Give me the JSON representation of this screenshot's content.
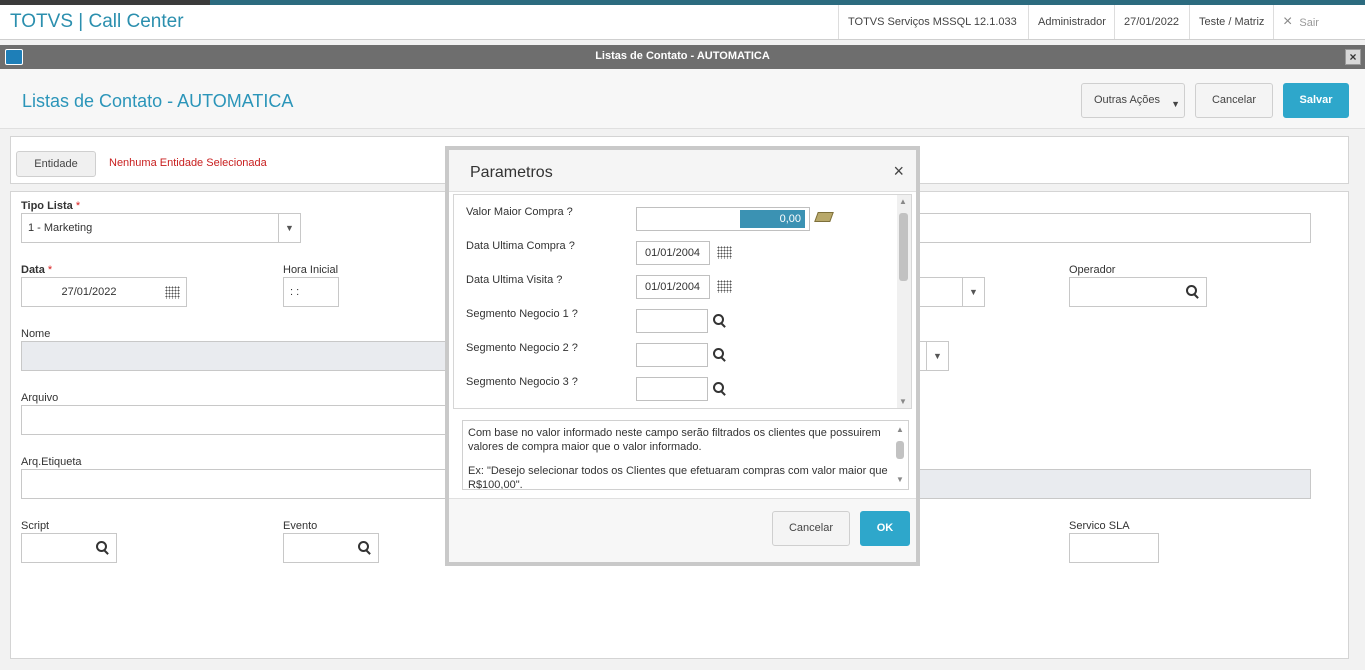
{
  "app": {
    "title": "TOTVS | Call Center",
    "environment": "TOTVS Serviços MSSQL 12.1.033",
    "user": "Administrador",
    "date": "27/01/2022",
    "branch": "Teste / Matriz",
    "exit_label": "Sair"
  },
  "window": {
    "title": "Listas de Contato - AUTOMATICA",
    "close_glyph": "×"
  },
  "page": {
    "title": "Listas de Contato - AUTOMATICA",
    "other_actions": "Outras Ações",
    "cancel": "Cancelar",
    "save": "Salvar"
  },
  "entity": {
    "button": "Entidade",
    "status": "Nenhuma Entidade Selecionada"
  },
  "form": {
    "tipo_lista_label": "Tipo Lista",
    "tipo_lista_value": "1 - Marketing",
    "data_label": "Data",
    "data_value": "27/01/2022",
    "hora_inicial_label": "Hora Inicial",
    "hora_inicial_value": " :  : ",
    "operador_label": "Operador",
    "nome_label": "Nome",
    "arquivo_label": "Arquivo",
    "arq_etiqueta_label": "Arq.Etiqueta",
    "script_label": "Script",
    "evento_label": "Evento",
    "servico_sla_label": "Servico SLA",
    "required_mark": "*"
  },
  "modal": {
    "title": "Parametros",
    "close_glyph": "×",
    "params": [
      {
        "label": "Valor Maior Compra ?",
        "value": "0,00"
      },
      {
        "label": "Data Ultima Compra ?",
        "value": "01/01/2004"
      },
      {
        "label": "Data Ultima Visita ?",
        "value": "01/01/2004"
      },
      {
        "label": "Segmento Negocio 1 ?",
        "value": ""
      },
      {
        "label": "Segmento Negocio 2 ?",
        "value": ""
      },
      {
        "label": "Segmento Negocio 3 ?",
        "value": ""
      }
    ],
    "help_p1": "Com base no valor informado neste campo serão filtrados os clientes que possuirem valores de compra maior que o valor informado.",
    "help_p2": "Ex: \"Desejo selecionar todos os Clientes que efetuaram compras com valor maior que R$100,00\".",
    "cancel": "Cancelar",
    "ok": "OK"
  },
  "colors": {
    "accent": "#2ea7cb",
    "required": "#d81b1b",
    "title": "#2b95b9"
  }
}
